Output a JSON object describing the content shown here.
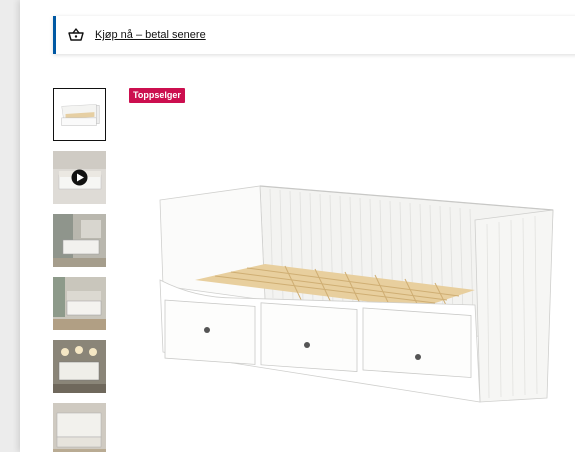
{
  "banner": {
    "link_label": "Kjøp nå – betal senere",
    "icon": "basket-icon"
  },
  "badge": {
    "label": "Toppselger",
    "color": "#cc0f4f"
  },
  "thumbnails": [
    {
      "name": "daybed-front",
      "active": true
    },
    {
      "name": "video",
      "active": false,
      "icon": "play-icon"
    },
    {
      "name": "room-scene-1",
      "active": false
    },
    {
      "name": "room-scene-2",
      "active": false
    },
    {
      "name": "room-scene-3",
      "active": false
    },
    {
      "name": "detail",
      "active": false
    }
  ],
  "colors": {
    "accent": "#0058a3",
    "badge": "#cc0f4f"
  }
}
